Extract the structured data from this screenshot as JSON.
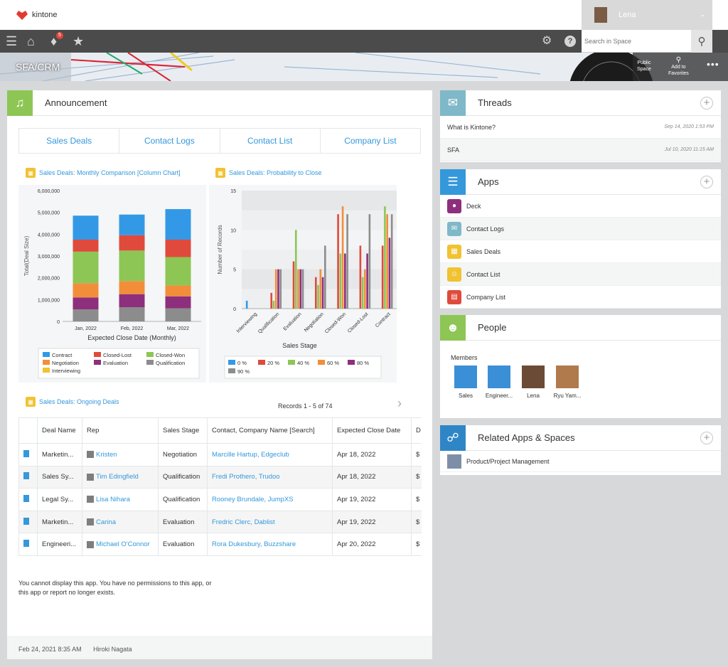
{
  "header": {
    "brand": "kintone",
    "user_name": "Lena",
    "search_placeholder": "Search in Space",
    "notification_count": "5"
  },
  "banner": {
    "space_title": "SFA/CRM",
    "public_label": "Public\nSpace",
    "favorites_label": "Add to\nFavorites"
  },
  "announcement": {
    "title": "Announcement",
    "tabs": [
      "Sales Deals",
      "Contact Logs",
      "Contact List",
      "Company List"
    ],
    "message": "You cannot display this app. You have no permissions to this app, or this app or report no longer exists.",
    "footer_date": "Feb 24, 2021 8:35 AM",
    "footer_author": "Hiroki Nagata"
  },
  "chart_titles": {
    "c1": "Sales Deals: Monthly Comparison [Column Chart]",
    "c2": "Sales Deals: Probability to Close",
    "list": "Sales Deals: Ongoing Deals"
  },
  "chart_data": [
    {
      "type": "bar",
      "stacked": true,
      "title": "Sales Deals: Monthly Comparison [Column Chart]",
      "xlabel": "Expected Close Date (Monthly)",
      "ylabel": "Total(Deal Size)",
      "ylim": [
        0,
        6000000
      ],
      "yticks": [
        "6,000,000",
        "5,000,000",
        "4,000,000",
        "3,000,000",
        "2,000,000",
        "1,000,000",
        "0"
      ],
      "categories": [
        "Jan, 2022",
        "Feb, 2022",
        "Mar, 2022"
      ],
      "series": [
        {
          "name": "Interviewing",
          "color": "#f1c232",
          "values": [
            0,
            0,
            0
          ]
        },
        {
          "name": "Qualification",
          "color": "#8c8c8c",
          "values": [
            550000,
            650000,
            600000
          ]
        },
        {
          "name": "Evaluation",
          "color": "#8e2f7d",
          "values": [
            550000,
            600000,
            550000
          ]
        },
        {
          "name": "Negotiation",
          "color": "#f28e3a",
          "values": [
            650000,
            600000,
            500000
          ]
        },
        {
          "name": "Closed-Won",
          "color": "#8dc654",
          "values": [
            1450000,
            1400000,
            1300000
          ]
        },
        {
          "name": "Closed-Lost",
          "color": "#e04a3c",
          "values": [
            550000,
            700000,
            800000
          ]
        },
        {
          "name": "Contract",
          "color": "#3399e6",
          "values": [
            1100000,
            950000,
            1400000
          ]
        }
      ],
      "legend": [
        "Contract",
        "Closed-Lost",
        "Closed-Won",
        "Negotiation",
        "Evaluation",
        "Qualification",
        "Interviewing"
      ]
    },
    {
      "type": "bar",
      "title": "Sales Deals: Probability to Close",
      "xlabel": "Sales Stage",
      "ylabel": "Number of Records",
      "ylim": [
        0,
        15
      ],
      "yticks": [
        "15",
        "10",
        "5",
        "0"
      ],
      "categories": [
        "Interviewing",
        "Qualification",
        "Evaluation",
        "Negotiation",
        "Closed-Won",
        "Closed-Lost",
        "Contract"
      ],
      "series": [
        {
          "name": "0 %",
          "color": "#3399e6",
          "values": [
            1,
            0,
            0,
            0,
            0,
            0,
            0
          ]
        },
        {
          "name": "20 %",
          "color": "#e04a3c",
          "values": [
            0,
            2,
            6,
            4,
            12,
            8,
            8
          ]
        },
        {
          "name": "40 %",
          "color": "#8dc654",
          "values": [
            0,
            1,
            10,
            3,
            7,
            4,
            13
          ]
        },
        {
          "name": "60 %",
          "color": "#f28e3a",
          "values": [
            0,
            5,
            5,
            5,
            13,
            5,
            12
          ]
        },
        {
          "name": "80 %",
          "color": "#8e2f7d",
          "values": [
            0,
            5,
            5,
            4,
            7,
            7,
            9
          ]
        },
        {
          "name": "90 %",
          "color": "#8c8c8c",
          "values": [
            0,
            5,
            5,
            8,
            12,
            12,
            12
          ]
        }
      ]
    }
  ],
  "deals": {
    "records_label": "Records 1 - 5  of 74",
    "columns": [
      "",
      "Deal Name",
      "Rep",
      "Sales Stage",
      "Contact, Company Name [Search]",
      "Expected Close Date",
      "D"
    ],
    "rows": [
      {
        "deal": "Marketin...",
        "rep": "Kristen",
        "stage": "Negotiation",
        "contact": "Marcille Hartup, Edgeclub",
        "date": "Apr 18, 2022",
        "d": "$"
      },
      {
        "deal": "Sales Sy...",
        "rep": "Tim Edingfield",
        "stage": "Qualification",
        "contact": "Fredi Prothero, Trudoo",
        "date": "Apr 18, 2022",
        "d": "$"
      },
      {
        "deal": "Legal Sy...",
        "rep": "Lisa Nihara",
        "stage": "Qualification",
        "contact": "Rooney Brundale, JumpXS",
        "date": "Apr 19, 2022",
        "d": "$"
      },
      {
        "deal": "Marketin...",
        "rep": "Carina",
        "stage": "Evaluation",
        "contact": "Fredric Clerc, Dablist",
        "date": "Apr 19, 2022",
        "d": "$"
      },
      {
        "deal": "Engineeri...",
        "rep": "Michael O'Connor",
        "stage": "Evaluation",
        "contact": "Rora Dukesbury, Buzzshare",
        "date": "Apr 20, 2022",
        "d": "$"
      }
    ]
  },
  "threads": {
    "title": "Threads",
    "items": [
      {
        "name": "What is Kintone?",
        "date": "Sep 14, 2020 1:53 PM"
      },
      {
        "name": "SFA",
        "date": "Jul 10, 2020 11:15 AM"
      }
    ]
  },
  "apps": {
    "title": "Apps",
    "items": [
      {
        "name": "Deck",
        "color": "#8e2f7d",
        "icon": "bulb-icon"
      },
      {
        "name": "Contact Logs",
        "color": "#7fb8c8",
        "icon": "chat-icon"
      },
      {
        "name": "Sales Deals",
        "color": "#f1c232",
        "icon": "clipboard-icon"
      },
      {
        "name": "Contact List",
        "color": "#f1c232",
        "icon": "id-card-icon"
      },
      {
        "name": "Company List",
        "color": "#e04a3c",
        "icon": "building-icon"
      }
    ]
  },
  "people": {
    "title": "People",
    "members_label": "Members",
    "members": [
      "Sales",
      "Engineer...",
      "Lena",
      "Ryu Yam..."
    ]
  },
  "related": {
    "title": "Related Apps & Spaces",
    "items": [
      "Product/Project Management"
    ]
  }
}
